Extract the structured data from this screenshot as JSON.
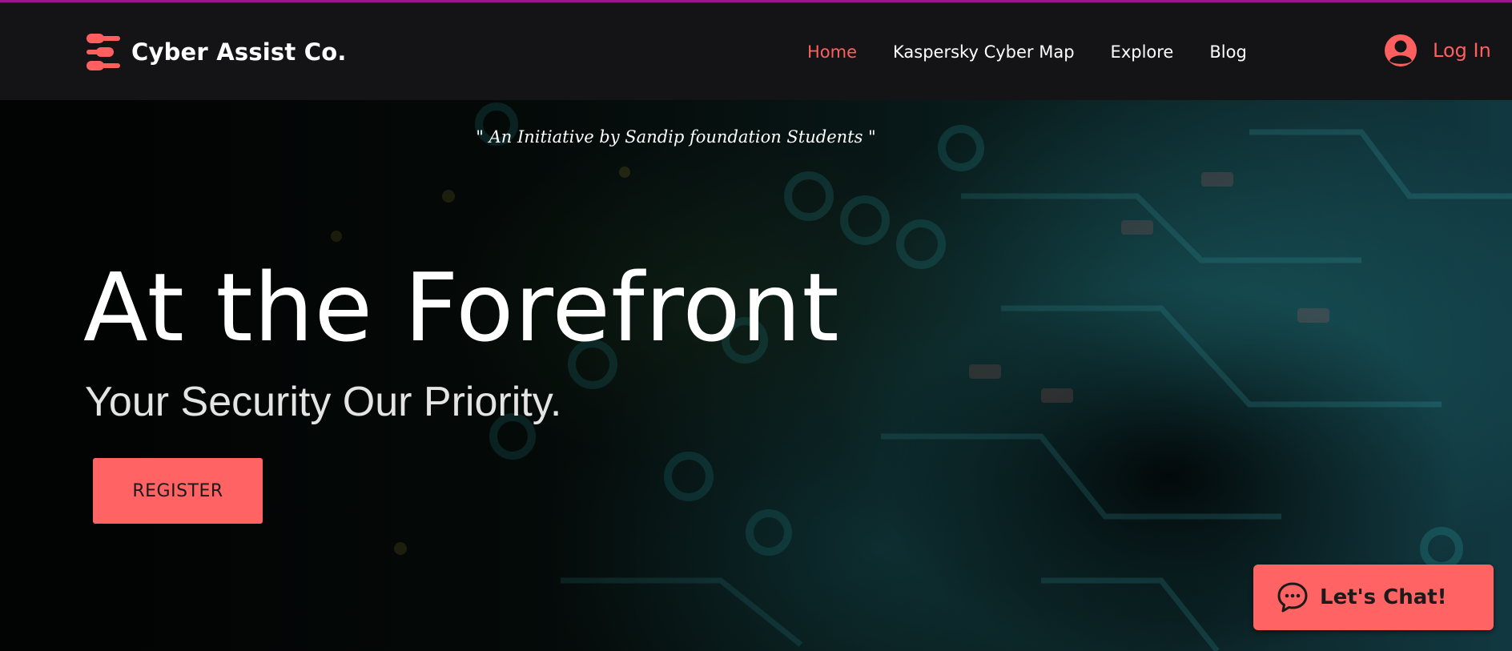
{
  "header": {
    "brand": "Cyber Assist Co.",
    "logo_icon": "stacked-pills-icon",
    "nav": [
      {
        "label": "Home",
        "active": true
      },
      {
        "label": "Kaspersky Cyber Map",
        "active": false
      },
      {
        "label": "Explore",
        "active": false
      },
      {
        "label": "Blog",
        "active": false
      }
    ],
    "login_label": "Log In",
    "login_icon": "user-avatar-icon"
  },
  "hero": {
    "tagline": "\" An Initiative by Sandip foundation Students \"",
    "title": "At the Forefront",
    "subtitle": "Your Security Our Priority.",
    "register_label": "REGISTER"
  },
  "chat": {
    "label": "Let's Chat!",
    "icon": "chat-bubble-icon"
  },
  "colors": {
    "accent": "#ff6363",
    "header_bg": "#141416",
    "top_line": "#a0168a",
    "active_nav": "#ff5f5f"
  }
}
